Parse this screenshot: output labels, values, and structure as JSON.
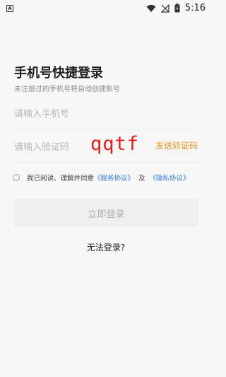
{
  "status_bar": {
    "app_icon_letter": "A",
    "time": "5:16"
  },
  "login": {
    "title": "手机号快捷登录",
    "subtitle": "未注册过的手机号将自动创建账号",
    "phone_placeholder": "请输入手机号",
    "code_placeholder": "请输入验证码",
    "send_code_label": "发送验证码",
    "overlay_text": "qqtf",
    "agreement_prefix": "我已阅读、理解并同意",
    "terms_link": "《服务协议》",
    "agreement_and": "及",
    "privacy_link": "《隐私协议》",
    "login_button": "立即登录",
    "cannot_login": "无法登录?"
  },
  "colors": {
    "accent_orange": "#f1901a",
    "link_blue": "#2f7de1",
    "overlay_red": "#e31c1c",
    "disabled_button_bg": "#efeff0"
  }
}
